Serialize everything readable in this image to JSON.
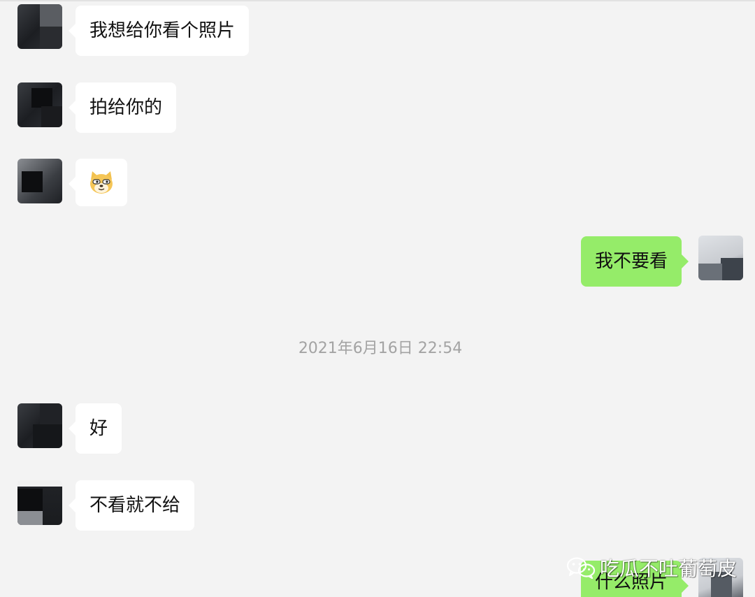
{
  "messages": [
    {
      "side": "left",
      "text": "我想给你看个照片"
    },
    {
      "side": "left",
      "text": "拍给你的"
    },
    {
      "side": "left",
      "emoji": "doge-emoji"
    },
    {
      "side": "right",
      "text": "我不要看"
    },
    {
      "side": "left",
      "text": "好"
    },
    {
      "side": "left",
      "text": "不看就不给"
    },
    {
      "side": "right",
      "text": "什么照片"
    }
  ],
  "timestamp": "2021年6月16日 22:54",
  "watermark": {
    "icon": "wechat-icon",
    "text": "吃瓜不吐葡萄皮"
  },
  "colors": {
    "background": "#f3f3f3",
    "incoming_bubble": "#ffffff",
    "outgoing_bubble": "#95ec69",
    "timestamp_text": "#a3a3a3"
  }
}
